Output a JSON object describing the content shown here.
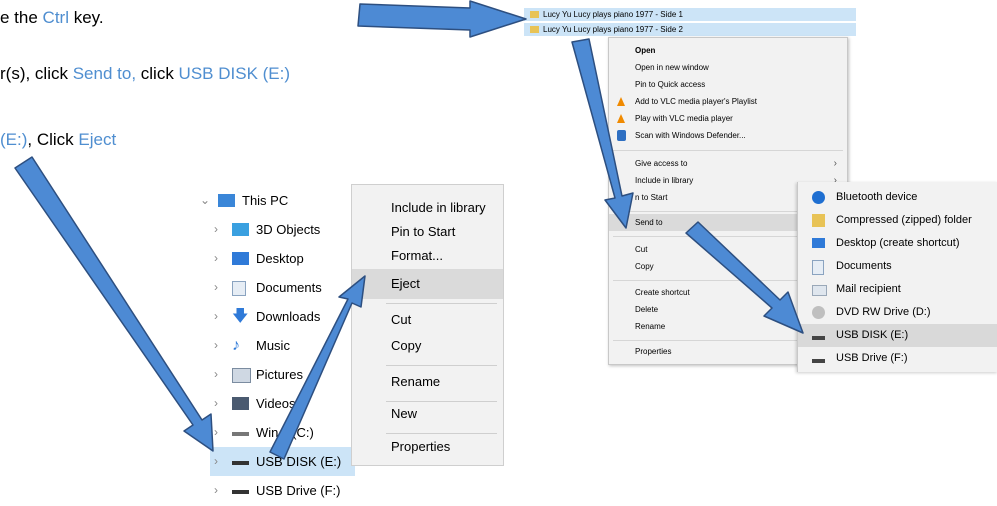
{
  "instructions": {
    "line1": {
      "pre": "e the ",
      "key": "Ctrl",
      "post": " key."
    },
    "line2": {
      "pre": "r(s), click ",
      "a": "Send to,",
      "mid": " click ",
      "b": "USB DISK (E:)"
    },
    "line3": {
      "a": "(E:)",
      "mid": ", Click ",
      "b": "Eject"
    }
  },
  "files": [
    "Lucy Yu Lucy plays piano 1977 - Side 1",
    "Lucy Yu Lucy plays piano 1977 - Side 2"
  ],
  "context_menu": {
    "open": "Open",
    "open_new_window": "Open in new window",
    "pin_quick_access": "Pin to Quick access",
    "add_vlc_playlist": "Add to VLC media player's Playlist",
    "play_vlc": "Play with VLC media player",
    "scan_defender": "Scan with Windows Defender...",
    "give_access": "Give access to",
    "include_library": "Include in library",
    "pin_start": "n to Start",
    "send_to": "Send to",
    "cut": "Cut",
    "copy": "Copy",
    "create_shortcut": "Create shortcut",
    "delete": "Delete",
    "rename": "Rename",
    "properties": "Properties"
  },
  "send_to_menu": {
    "bluetooth": "Bluetooth device",
    "zip": "Compressed (zipped) folder",
    "desktop": "Desktop (create shortcut)",
    "documents": "Documents",
    "mail": "Mail recipient",
    "dvd": "DVD RW Drive (D:)",
    "usb_disk": "USB DISK (E:)",
    "usb_drive": "USB Drive (F:)"
  },
  "tree": {
    "this_pc": "This PC",
    "objects3d": "3D Objects",
    "desktop": "Desktop",
    "documents": "Documents",
    "downloads": "Downloads",
    "music": "Music",
    "pictures": "Pictures",
    "videos": "Videos",
    "windows": "Win      s (C:)",
    "usb_disk": "USB DISK (E:)",
    "usb_drive": "USB Drive (F:)"
  },
  "drive_menu": {
    "include_library": "Include in library",
    "pin_start": "Pin to Start",
    "format": "Format...",
    "eject": "Eject",
    "cut": "Cut",
    "copy": "Copy",
    "rename": "Rename",
    "new": "New",
    "properties": "Properties"
  },
  "colors": {
    "accent_text": "#4f8ed0",
    "arrow_fill": "#4d8ad4",
    "arrow_stroke": "#2d4f80",
    "selection": "#cce4f7"
  }
}
